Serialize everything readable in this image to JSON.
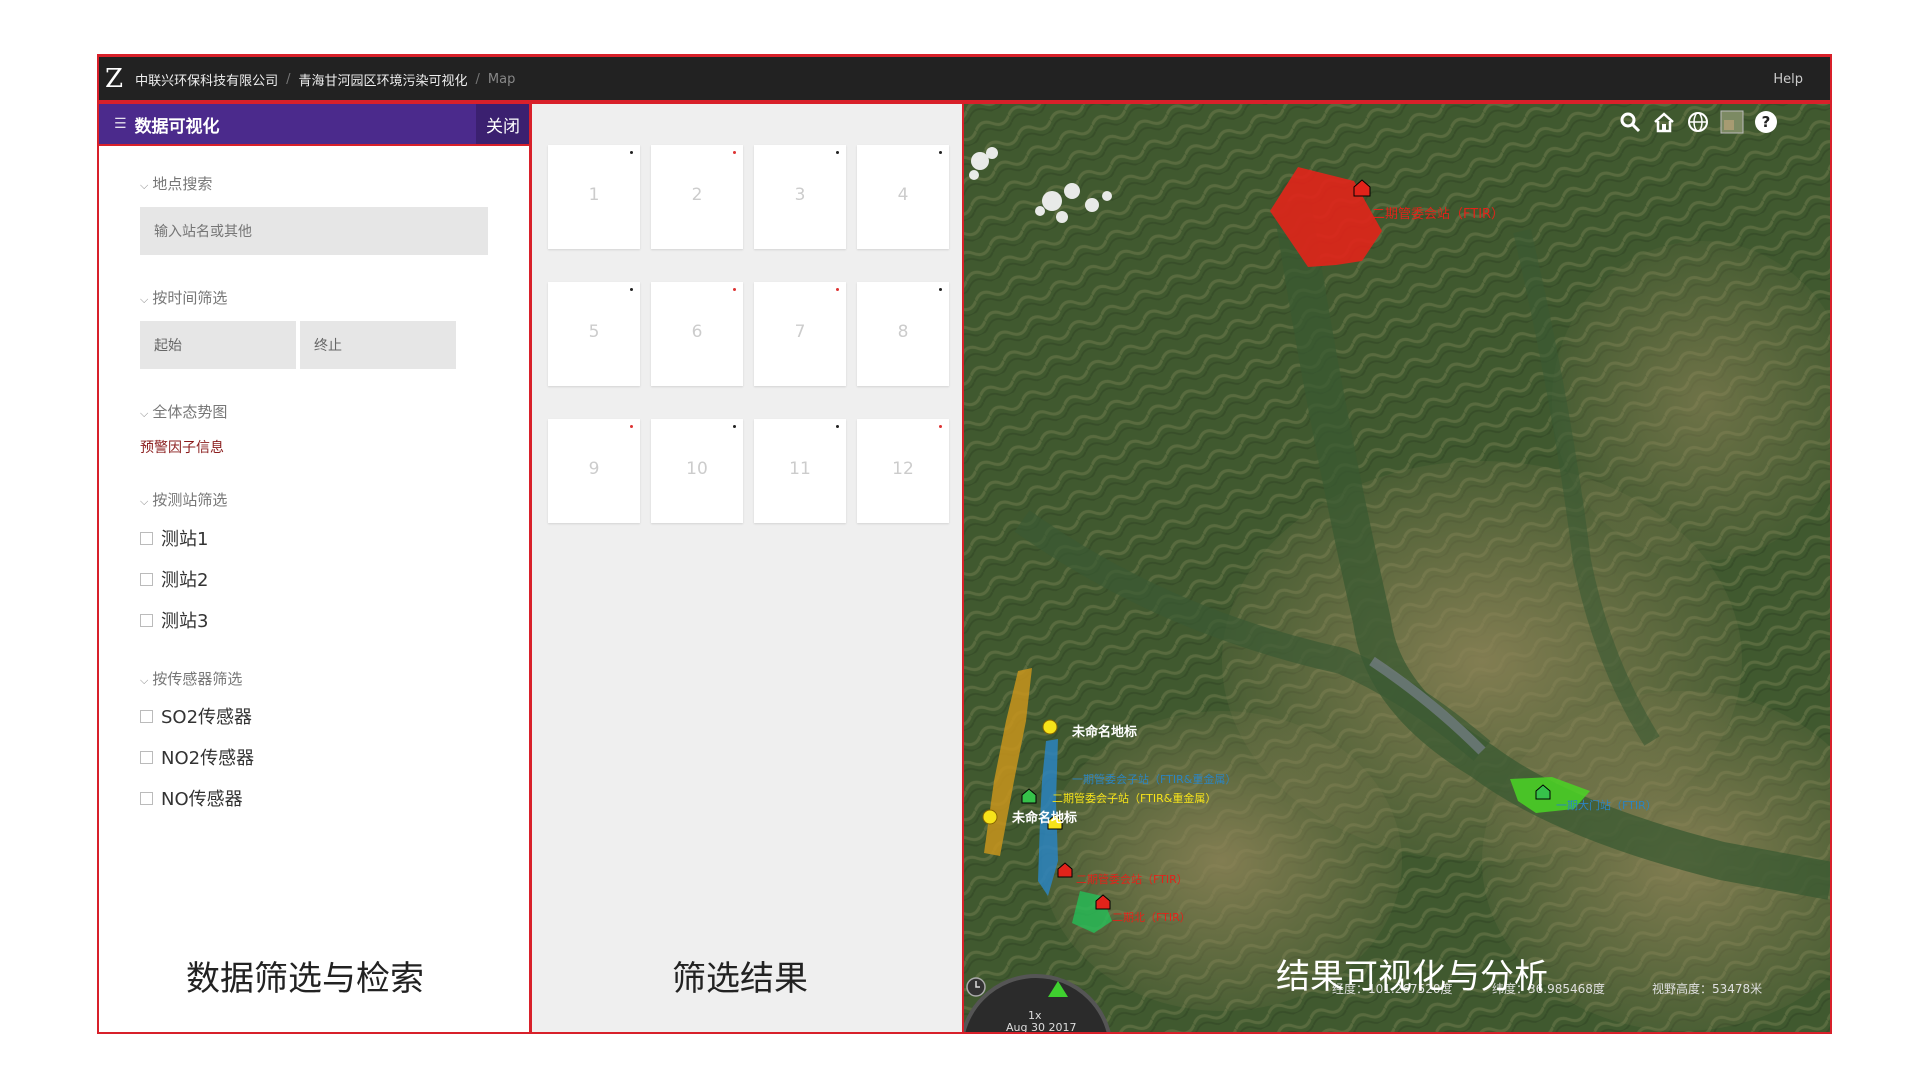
{
  "topbar": {
    "logo": "Z",
    "breadcrumb": [
      "中联兴环保科技有限公司",
      "青海甘河园区环境污染可视化",
      "Map"
    ],
    "help": "Help"
  },
  "sidebar": {
    "title": "数据可视化",
    "close_label": "关闭",
    "location_search": {
      "label": "地点搜索",
      "placeholder": "输入站名或其他"
    },
    "time_filter": {
      "label": "按时间筛选",
      "start": "起始",
      "end": "终止"
    },
    "overview": {
      "label": "全体态势图",
      "link": "预警因子信息"
    },
    "station_filter": {
      "label": "按测站筛选",
      "items": [
        "测站1",
        "测站2",
        "测站3"
      ]
    },
    "sensor_filter": {
      "label": "按传感器筛选",
      "items": [
        "SO2传感器",
        "NO2传感器",
        "NO传感器"
      ]
    },
    "caption": "数据筛选与检索"
  },
  "results": {
    "tiles": [
      "1",
      "2",
      "3",
      "4",
      "5",
      "6",
      "7",
      "8",
      "9",
      "10",
      "11",
      "12"
    ],
    "tile_dot_colors": [
      "#222",
      "#d33",
      "#222",
      "#222",
      "#222",
      "#d33",
      "#d33",
      "#222",
      "#d33",
      "#222",
      "#222",
      "#d33"
    ],
    "caption": "筛选结果"
  },
  "map": {
    "tools": [
      "search-icon",
      "home-icon",
      "globe-icon",
      "layers-icon",
      "help-icon"
    ],
    "caption": "结果可视化与分析",
    "status": {
      "longitude": "经度：101.267520度",
      "latitude": "纬度：36.985468度",
      "view_height": "视野高度：53478米"
    },
    "clock": {
      "speed": "1x",
      "date": "Aug 30 2017"
    },
    "labels": {
      "label_top": "二期管委会站（FTIR）",
      "unnamed_1": "未命名地标",
      "unnamed_2": "未命名地标",
      "label_yellow": "二期管委会子站（FTIR&重金属）",
      "label_blue": "一期管委会子站（FTIR&重金属）",
      "label_red1": "二期管委会站（FTIR）",
      "label_red2": "二期北（FTIR）",
      "label_right": "一期大门站（FTIR）"
    }
  },
  "colors": {
    "header_purple": "#4b2a8c",
    "highlight_red": "#d8202a",
    "topbar": "#222222"
  }
}
